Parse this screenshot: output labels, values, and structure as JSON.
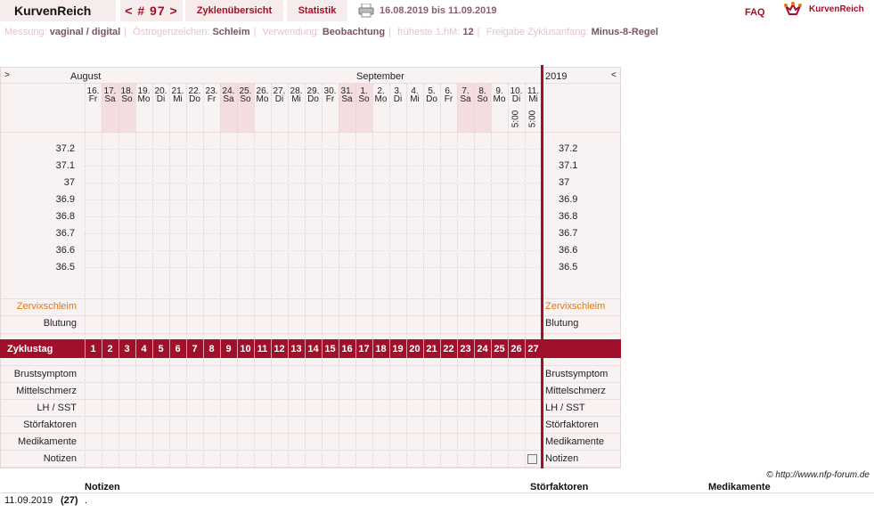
{
  "app": {
    "name": "KurvenReich",
    "cycle_label": "< # 97 >",
    "tab_cycles": "Zyklenübersicht",
    "tab_stats": "Statistik",
    "date_range": "16.08.2019 bis 11.09.2019",
    "faq": "FAQ",
    "logo_text": "KurvenReich"
  },
  "settings": [
    {
      "label": "Messung:",
      "value": "vaginal / digital"
    },
    {
      "label": "Östrogenzeichen:",
      "value": "Schleim"
    },
    {
      "label": "Verwendung:",
      "value": "Beobachtung"
    },
    {
      "label": "früheste 1.hM:",
      "value": "12"
    },
    {
      "label": "Freigabe Zyklusanfang:",
      "value": "Minus-8-Regel"
    }
  ],
  "chart": {
    "nav_prev": ">",
    "nav_next": "<",
    "month_left": "August",
    "month_mid": "September",
    "year": "2019",
    "days": [
      {
        "d": "16.",
        "w": "Fr",
        "we": false
      },
      {
        "d": "17.",
        "w": "Sa",
        "we": true
      },
      {
        "d": "18.",
        "w": "So",
        "we": true
      },
      {
        "d": "19.",
        "w": "Mo",
        "we": false
      },
      {
        "d": "20.",
        "w": "Di",
        "we": false
      },
      {
        "d": "21.",
        "w": "Mi",
        "we": false
      },
      {
        "d": "22.",
        "w": "Do",
        "we": false
      },
      {
        "d": "23.",
        "w": "Fr",
        "we": false
      },
      {
        "d": "24.",
        "w": "Sa",
        "we": true
      },
      {
        "d": "25.",
        "w": "So",
        "we": true
      },
      {
        "d": "26.",
        "w": "Mo",
        "we": false
      },
      {
        "d": "27.",
        "w": "Di",
        "we": false
      },
      {
        "d": "28.",
        "w": "Mi",
        "we": false
      },
      {
        "d": "29.",
        "w": "Do",
        "we": false
      },
      {
        "d": "30.",
        "w": "Fr",
        "we": false
      },
      {
        "d": "31.",
        "w": "Sa",
        "we": true
      },
      {
        "d": "1.",
        "w": "So",
        "we": true
      },
      {
        "d": "2.",
        "w": "Mo",
        "we": false
      },
      {
        "d": "3.",
        "w": "Di",
        "we": false
      },
      {
        "d": "4.",
        "w": "Mi",
        "we": false
      },
      {
        "d": "5.",
        "w": "Do",
        "we": false
      },
      {
        "d": "6.",
        "w": "Fr",
        "we": false
      },
      {
        "d": "7.",
        "w": "Sa",
        "we": true
      },
      {
        "d": "8.",
        "w": "So",
        "we": true
      },
      {
        "d": "9.",
        "w": "Mo",
        "we": false
      },
      {
        "d": "10.",
        "w": "Di",
        "we": false,
        "t": "5:00"
      },
      {
        "d": "11.",
        "w": "Mi",
        "we": false,
        "t": "5:00"
      }
    ],
    "temps": [
      "37.2",
      "37.1",
      "37",
      "36.9",
      "36.8",
      "36.7",
      "36.6",
      "36.5"
    ],
    "row_zervix": "Zervixschleim",
    "row_blutung": "Blutung",
    "row_zyklustag": "Zyklustag",
    "cycle_days": [
      "1",
      "2",
      "3",
      "4",
      "5",
      "6",
      "7",
      "8",
      "9",
      "10",
      "11",
      "12",
      "13",
      "14",
      "15",
      "16",
      "17",
      "18",
      "19",
      "20",
      "21",
      "22",
      "23",
      "24",
      "25",
      "26",
      "27"
    ],
    "rows_bottom": [
      "Brustsymptom",
      "Mittelschmerz",
      "LH / SST",
      "Störfaktoren",
      "Medikamente",
      "Notizen"
    ]
  },
  "colors": {
    "accent": "#a0102a",
    "weekend": "#f3dde1",
    "panel": "#f9f2f2",
    "zervix": "#e07a10"
  },
  "footer": {
    "copyright": "© http://www.nfp-forum.de",
    "h_notes": "Notizen",
    "h_stoer": "Störfaktoren",
    "h_medi": "Medikamente",
    "note_date": "11.09.2019",
    "note_day": "(27)",
    "note_text": "."
  }
}
